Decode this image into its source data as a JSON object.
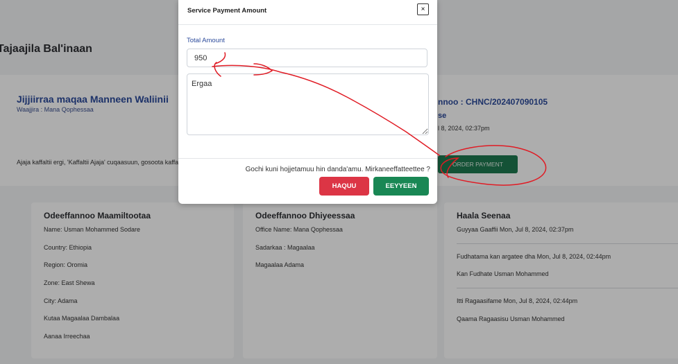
{
  "page": {
    "title": "Tajaajila Bal'inaan",
    "office_title": "Jijjiirraa maqaa Manneen Waliinii",
    "office_subtitle": "Waajjira : Mana Qophessaa",
    "notice": "Ajaja kaffaltii ergi, 'Kaffaltii Ajaja' cuqaasuun, gosoota kaffaltii",
    "reference_number": "nnoo : CHNC/202407090105",
    "reference_type": "se",
    "reference_date": "l 8, 2024, 02:37pm",
    "order_button": "ORDER PAYMENT"
  },
  "cards": {
    "customer": {
      "title": "Odeeffannoo Maamiltootaa",
      "lines": [
        "Name: Usman Mohammed Sodare",
        "Country: Ethiopia",
        "Region: Oromia",
        "Zone: East Shewa",
        "City: Adama",
        "Kutaa Magaalaa Dambalaa",
        "Aanaa Irreechaa"
      ]
    },
    "provider": {
      "title": "Odeeffannoo Dhiyeessaa",
      "lines": [
        "Office Name: Mana Qophessaa",
        "Sadarkaa : Magaalaa",
        "Magaalaa Adama"
      ]
    },
    "status": {
      "title": "Haala Seenaa",
      "lines": [
        "Guyyaa Gaaffii Mon, Jul 8, 2024, 02:37pm",
        "Fudhatama kan argatee dha Mon, Jul 8, 2024, 02:44pm",
        "Kan Fudhate Usman Mohammed",
        "Itti Ragaasifame Mon, Jul 8, 2024, 02:44pm",
        "Qaama Ragaasisu Usman Mohammed"
      ]
    }
  },
  "modal": {
    "title": "Service Payment Amount",
    "close_label": "×",
    "amount_label": "Total Amount",
    "amount_value": "950",
    "note_value": "Ergaa",
    "confirm_text": "Gochi kuni hojjetamuu hin danda'amu. Mirkaneeffatteettee ?",
    "cancel_label": "HAQUU",
    "yes_label": "EEYYEEN"
  },
  "colors": {
    "annotation": "#e01b24",
    "primary_blue": "#2b4a9b",
    "success": "#198754",
    "danger": "#dc3545"
  }
}
